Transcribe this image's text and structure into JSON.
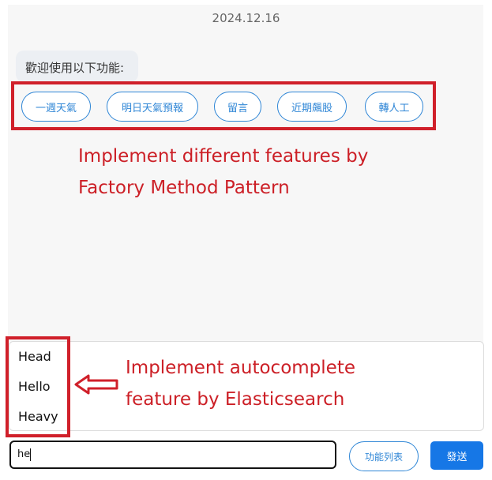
{
  "chat": {
    "date": "2024.12.16",
    "welcome": "歡迎使用以下功能:",
    "options": [
      "一週天氣",
      "明日天氣預報",
      "留言",
      "近期飆股",
      "轉人工"
    ]
  },
  "annotations": {
    "factory_line1": "Implement different features by",
    "factory_line2": "Factory Method Pattern",
    "auto_line1": "Implement autocomplete",
    "auto_line2": "feature by Elasticsearch"
  },
  "suggestions": [
    "Head",
    "Hello",
    "Heavy"
  ],
  "input": {
    "value": "he"
  },
  "buttons": {
    "function_list": "功能列表",
    "send": "發送"
  },
  "colors": {
    "accent": "#2f86d6",
    "send": "#1677e6",
    "annotation": "#d0202a"
  }
}
